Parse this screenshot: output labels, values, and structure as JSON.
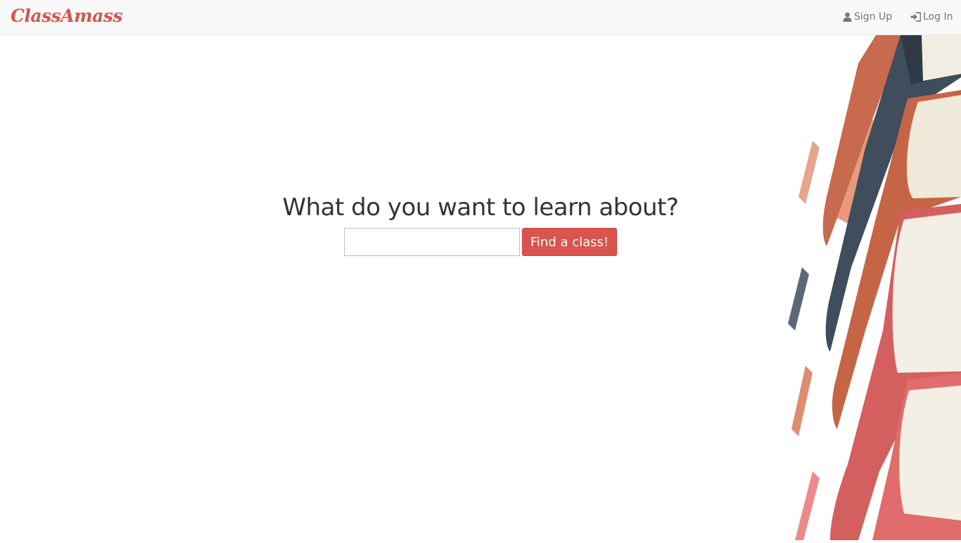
{
  "brand": {
    "name": "ClassAmass",
    "color": "#d9534f"
  },
  "nav": {
    "signup": {
      "label": "Sign Up",
      "icon": "user-icon"
    },
    "login": {
      "label": "Log In",
      "icon": "log-in-icon"
    }
  },
  "hero": {
    "title": "What do you want to learn about?",
    "search_value": "",
    "search_placeholder": "",
    "button_label": "Find a class!",
    "button_color": "#d9534f"
  },
  "decor": {
    "image": "stack-of-books-illustration"
  }
}
